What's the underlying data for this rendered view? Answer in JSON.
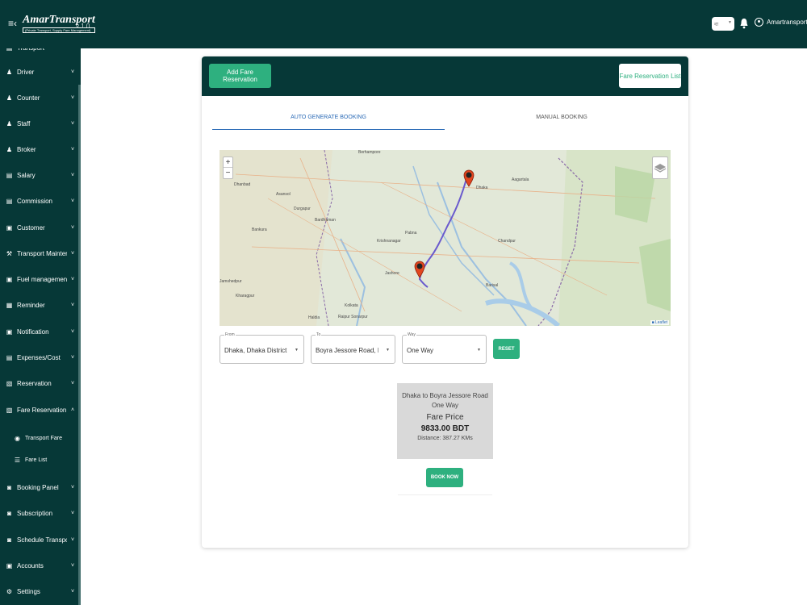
{
  "app": {
    "brand": "AmarTransport",
    "tagline": "(Private Transport, Supply Fare Management)",
    "version": "v 1.0",
    "language": "বা",
    "user": "Amartransport"
  },
  "colors": {
    "primary": "#063837",
    "accent": "#2eb07f",
    "tab_active": "#2a6ab6",
    "route": "#6a5acd"
  },
  "sidebar": {
    "items": [
      {
        "label": "Transport",
        "icon": "bus-icon",
        "glyph": "▤",
        "expanded": false
      },
      {
        "label": "Driver",
        "icon": "person-icon",
        "glyph": "♟",
        "expanded": false
      },
      {
        "label": "Counter",
        "icon": "person-icon",
        "glyph": "♟",
        "expanded": false
      },
      {
        "label": "Staff",
        "icon": "person-icon",
        "glyph": "♟",
        "expanded": false
      },
      {
        "label": "Broker",
        "icon": "person-icon",
        "glyph": "♟",
        "expanded": false
      },
      {
        "label": "Salary",
        "icon": "wallet-icon",
        "glyph": "▤",
        "expanded": false
      },
      {
        "label": "Commission",
        "icon": "wallet-icon",
        "glyph": "▤",
        "expanded": false
      },
      {
        "label": "Customer",
        "icon": "id-card-icon",
        "glyph": "▣",
        "expanded": false
      },
      {
        "label": "Transport Maintenance",
        "icon": "tools-icon",
        "glyph": "⚒",
        "expanded": false
      },
      {
        "label": "Fuel management",
        "icon": "fuel-icon",
        "glyph": "▣",
        "expanded": false
      },
      {
        "label": "Reminder",
        "icon": "calendar-icon",
        "glyph": "▦",
        "expanded": false
      },
      {
        "label": "Notification",
        "icon": "notification-icon",
        "glyph": "▣",
        "expanded": false
      },
      {
        "label": "Expenses/Cost",
        "icon": "expenses-icon",
        "glyph": "▤",
        "expanded": false
      },
      {
        "label": "Reservation",
        "icon": "reservation-icon",
        "glyph": "▧",
        "expanded": false
      },
      {
        "label": "Fare Reservation",
        "icon": "reservation-icon",
        "glyph": "▧",
        "expanded": true
      },
      {
        "label": "Booking Panel",
        "icon": "booking-icon",
        "glyph": "◙",
        "expanded": false
      },
      {
        "label": "Subscription",
        "icon": "subscription-icon",
        "glyph": "◙",
        "expanded": false
      },
      {
        "label": "Schedule Transport",
        "icon": "schedule-icon",
        "glyph": "◙",
        "expanded": false
      },
      {
        "label": "Accounts",
        "icon": "accounts-icon",
        "glyph": "▣",
        "expanded": false
      },
      {
        "label": "Settings",
        "icon": "gear-icon",
        "glyph": "⚙",
        "expanded": false
      }
    ],
    "subitems": [
      {
        "label": "Transport Fare",
        "icon": "radio-icon",
        "glyph": "◉"
      },
      {
        "label": "Fare List",
        "icon": "list-icon",
        "glyph": "☰"
      }
    ]
  },
  "header": {
    "add_button": "Add Fare Reservation",
    "list_button": "Fare Reservation List"
  },
  "tabs": [
    {
      "label": "AUTO GENERATE BOOKING",
      "active": true
    },
    {
      "label": "MANUAL BOOKING",
      "active": false
    }
  ],
  "map": {
    "zoom_in": "+",
    "zoom_out": "−",
    "attribution": "Leaflet",
    "places": [
      "Dhanbad",
      "Asansol",
      "Bardhaman",
      "Kolkata",
      "Jamshedpur",
      "Raipur Sonarpur",
      "Aagartala",
      "Durgapur",
      "Bankura",
      "Krishnanagar",
      "Barisal",
      "Jashore",
      "Pabna",
      "Berhampore",
      "Kharagpur",
      "Haldia",
      "Chandpur",
      "Dhaka"
    ]
  },
  "form": {
    "from": {
      "label": "From",
      "value": "Dhaka, Dhaka District, B..."
    },
    "to": {
      "label": "To",
      "value": "Boyra Jessore Road, Boyra"
    },
    "way": {
      "label": "Way",
      "value": "One Way"
    },
    "reset": "RESET"
  },
  "fare": {
    "route": "Dhaka to Boyra Jessore Road One Way",
    "title": "Fare Price",
    "price": "9833.00 BDT",
    "distance": "Distance: 387.27 KMs",
    "book": "BOOK NOW"
  }
}
